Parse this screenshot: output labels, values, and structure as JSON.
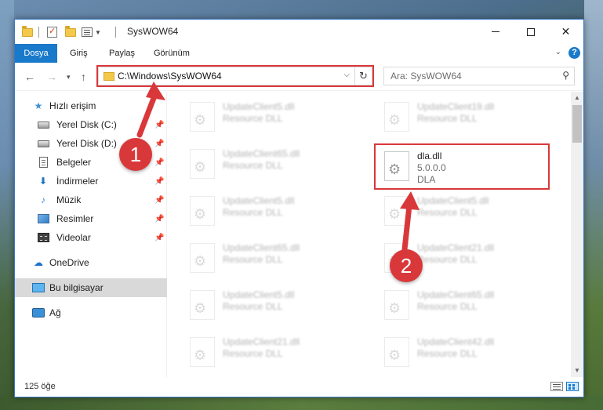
{
  "window": {
    "title": "SysWOW64",
    "controls": {
      "minimize": "minimize",
      "maximize": "maximize",
      "close": "✕"
    }
  },
  "ribbon": {
    "tabs": [
      "Dosya",
      "Giriş",
      "Paylaş",
      "Görünüm"
    ],
    "help": "?"
  },
  "address": {
    "path": "C:\\Windows\\SysWOW64",
    "search_placeholder": "Ara: SysWOW64"
  },
  "nav_pane": {
    "items": [
      {
        "label": "Hızlı erişim",
        "icon": "star-icon",
        "pinned": false
      },
      {
        "label": "Yerel Disk (C:)",
        "icon": "disk-icon",
        "pinned": true
      },
      {
        "label": "Yerel Disk (D:)",
        "icon": "disk-icon",
        "pinned": true
      },
      {
        "label": "Belgeler",
        "icon": "document-icon",
        "pinned": true
      },
      {
        "label": "İndirmeler",
        "icon": "download-icon",
        "pinned": true
      },
      {
        "label": "Müzik",
        "icon": "music-icon",
        "pinned": true
      },
      {
        "label": "Resimler",
        "icon": "pictures-icon",
        "pinned": true
      },
      {
        "label": "Videolar",
        "icon": "videos-icon",
        "pinned": true
      },
      {
        "label": "OneDrive",
        "icon": "cloud-icon",
        "pinned": false
      },
      {
        "label": "Bu bilgisayar",
        "icon": "computer-icon",
        "pinned": false
      },
      {
        "label": "Ağ",
        "icon": "network-icon",
        "pinned": false
      }
    ]
  },
  "files": {
    "left_column": [
      {
        "name": "UpdateClient5.dll",
        "type": "Resource DLL"
      },
      {
        "name": "UpdateClient65.dll",
        "type": "Resource DLL"
      },
      {
        "name": "UpdateClient5.dll",
        "type": "Resource DLL"
      },
      {
        "name": "UpdateClient65.dll",
        "type": "Resource DLL"
      },
      {
        "name": "UpdateClient5.dll",
        "type": "Resource DLL"
      },
      {
        "name": "UpdateClient21.dll",
        "type": "Resource DLL"
      }
    ],
    "right_column": [
      {
        "name": "UpdateClient19.dll",
        "type": "Resource DLL"
      },
      {
        "name": "UpdateClient5.dll",
        "type": "Resource DLL"
      },
      {
        "name": "UpdateClient21.dll",
        "type": "Resource DLL"
      },
      {
        "name": "UpdateClient65.dll",
        "type": "Resource DLL"
      },
      {
        "name": "UpdateClient42.dll",
        "type": "Resource DLL"
      }
    ],
    "highlighted": {
      "name": "dla.dll",
      "version": "5.0.0.0",
      "description": "DLA"
    }
  },
  "status": {
    "count": "125 öğe"
  },
  "callouts": {
    "one": "1",
    "two": "2",
    "color": "#d9383a"
  }
}
